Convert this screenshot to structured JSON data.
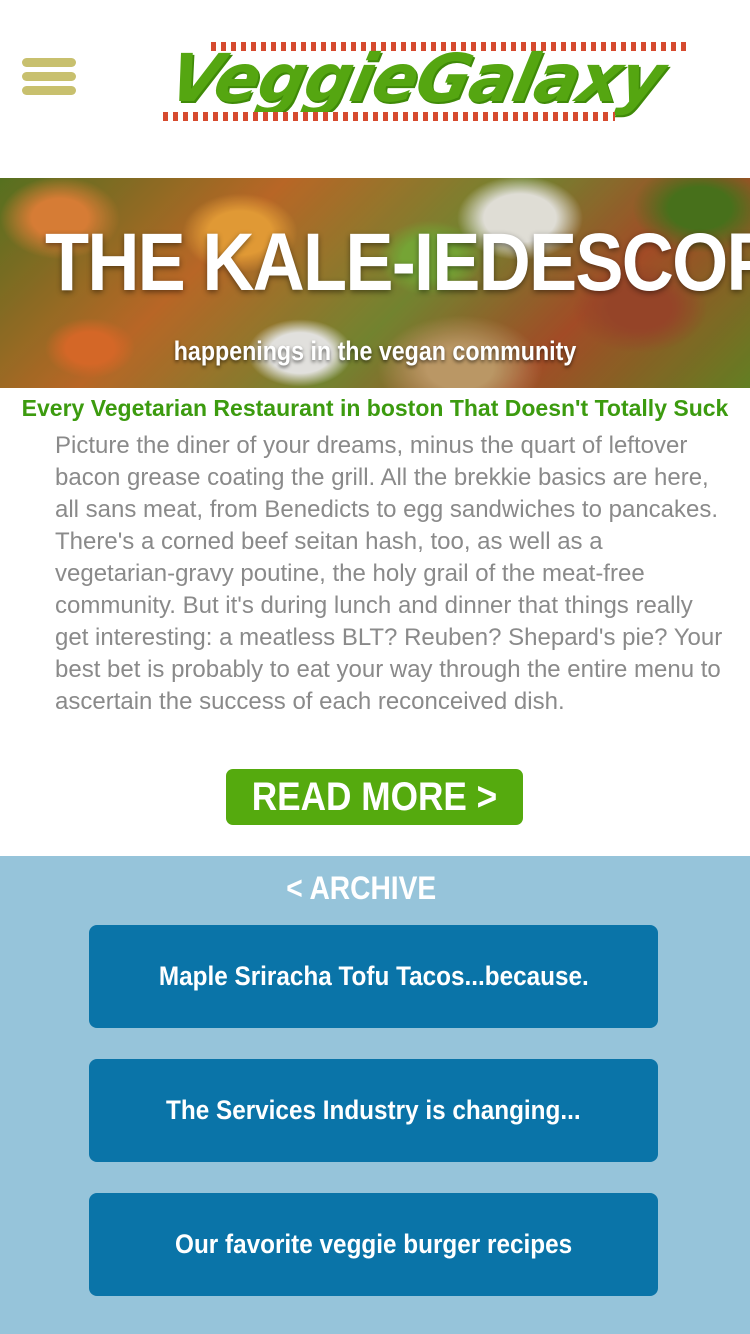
{
  "header": {
    "menu_icon": "hamburger-menu-icon",
    "logo_text": "VeggieGalaxy",
    "logo_color": "#55a611",
    "menu_color": "#c8c06e"
  },
  "hero": {
    "title": "THE KALE-IEDESCOPE",
    "subtitle": "happenings in the vegan community"
  },
  "article": {
    "heading": "Every Vegetarian Restaurant in boston That Doesn't Totally Suck",
    "body": "Picture the diner of your dreams, minus the quart of leftover bacon grease coating the grill. All the brekkie basics are here, all sans meat, from Benedicts to egg sandwiches to pancakes. There's a corned beef seitan hash, too, as well as a vegetarian-gravy poutine, the holy grail of the meat-free community. But it's during lunch and dinner that things really get interesting: a meatless BLT? Reuben? Shepard's pie? Your best bet is probably to eat your way through the entire menu to ascertain the success of each reconceived dish.",
    "read_more_label": "READ MORE >",
    "accent_color": "#55aa0e"
  },
  "archive": {
    "title": "< ARCHIVE",
    "background": "#96c4da",
    "button_color": "#0a74a8",
    "items": [
      {
        "label": "Maple Sriracha Tofu Tacos...because."
      },
      {
        "label": "The Services Industry is changing..."
      },
      {
        "label": "Our favorite veggie burger recipes"
      }
    ]
  }
}
